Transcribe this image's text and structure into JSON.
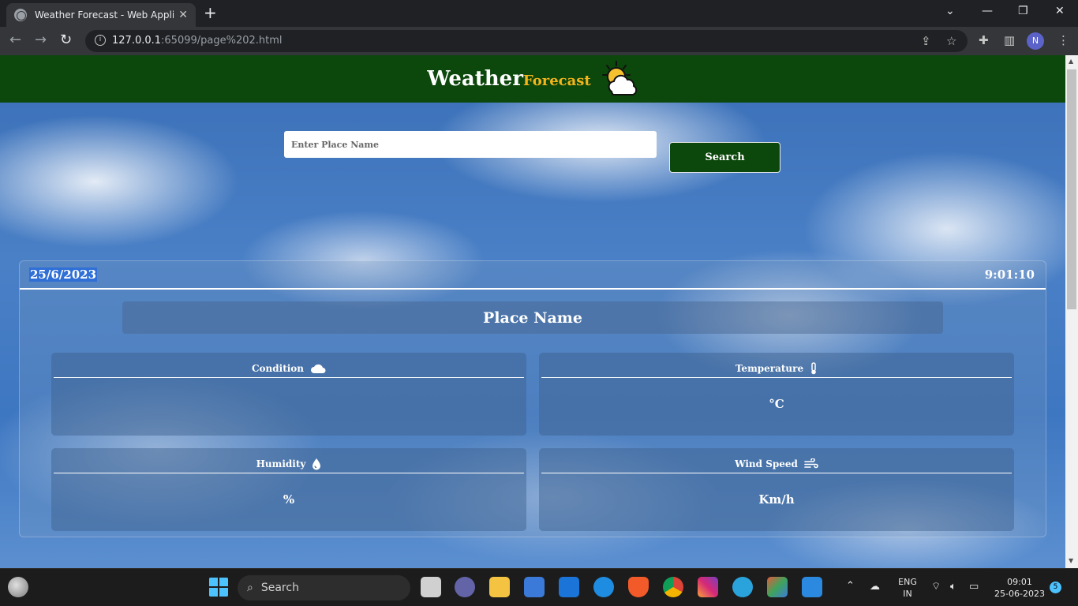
{
  "browser": {
    "tab_title": "Weather Forecast - Web Applicat",
    "tab_close": "✕",
    "new_tab": "+",
    "url_host": "127.0.0.1",
    "url_rest": ":65099/page%202.html",
    "profile_initial": "N"
  },
  "site": {
    "brand_weather": "Weather",
    "brand_forecast": "Forecast",
    "colors": {
      "header": "#0c470b",
      "accent": "#f4b41a"
    }
  },
  "search": {
    "placeholder": "Enter Place Name",
    "button_label": "Search"
  },
  "panel": {
    "date": "25/6/2023",
    "time": "9:01:10",
    "place": "Place Name"
  },
  "cards": {
    "condition": {
      "label": "Condition",
      "icon": "cloud-icon",
      "value": ""
    },
    "temperature": {
      "label": "Temperature",
      "icon": "thermometer-icon",
      "value": "°C"
    },
    "humidity": {
      "label": "Humidity",
      "icon": "droplet-icon",
      "value": "%"
    },
    "wind": {
      "label": "Wind Speed",
      "icon": "wind-icon",
      "value": "Km/h"
    }
  },
  "taskbar": {
    "search_label": "Search",
    "lang_line1": "ENG",
    "lang_line2": "IN",
    "clock_time": "09:01",
    "clock_date": "25-06-2023",
    "notification_count": "5"
  }
}
